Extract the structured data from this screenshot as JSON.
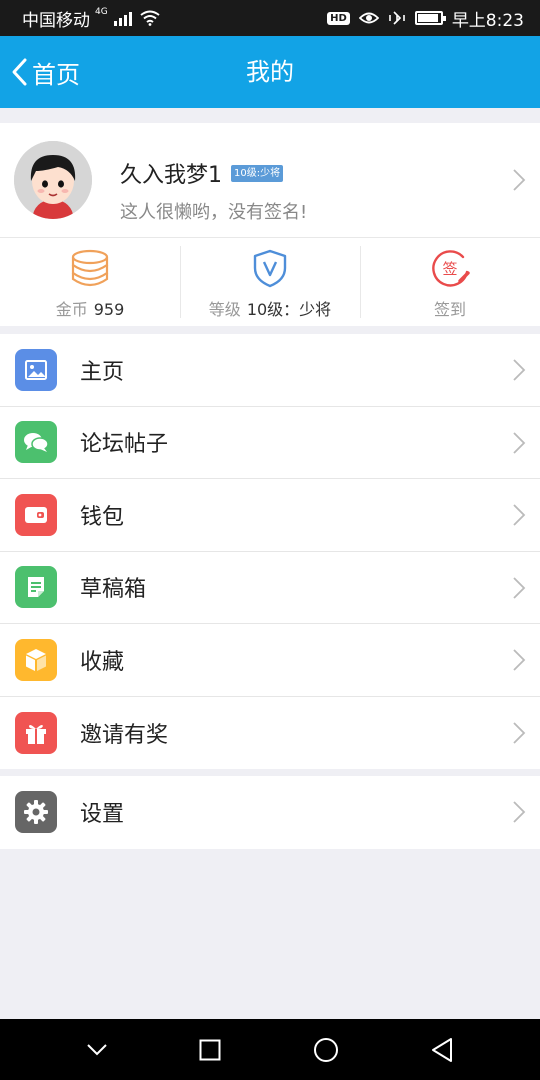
{
  "status_bar": {
    "carrier": "中国移动",
    "network": "4G",
    "hd": "HD",
    "time": "早上8:23"
  },
  "header": {
    "back_label": "首页",
    "title": "我的"
  },
  "profile": {
    "username": "久入我梦1",
    "level_badge": "10级:少将",
    "signature": "这人很懒哟，没有签名!"
  },
  "stats": {
    "coins_label": "金币",
    "coins_value": "959",
    "level_label": "等级",
    "level_value": "10级：少将",
    "checkin_label": "签到",
    "checkin_icon_text": "签"
  },
  "menu": [
    {
      "label": "主页",
      "icon": "image-icon",
      "color": "#5b8ee6"
    },
    {
      "label": "论坛帖子",
      "icon": "chat-bubbles-icon",
      "color": "#4cc06e"
    },
    {
      "label": "钱包",
      "icon": "wallet-icon",
      "color": "#f05452"
    },
    {
      "label": "草稿箱",
      "icon": "draft-icon",
      "color": "#4cc06e"
    },
    {
      "label": "收藏",
      "icon": "cube-icon",
      "color": "#ffb82e"
    },
    {
      "label": "邀请有奖",
      "icon": "gift-icon",
      "color": "#f05452"
    }
  ],
  "settings": {
    "label": "设置",
    "icon": "gear-icon",
    "color": "#666666"
  },
  "colors": {
    "title_bar": "#12a3e6",
    "status_bar": "#1a1a1a",
    "background": "#efeff4"
  }
}
